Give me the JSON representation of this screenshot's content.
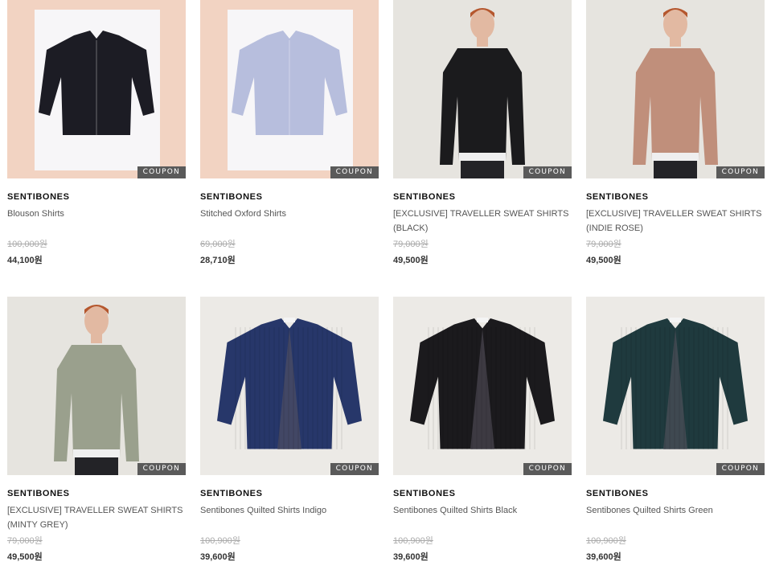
{
  "products": [
    {
      "brand": "SENTIBONES",
      "name": "Blouson Shirts",
      "old_price": "100,000원",
      "price": "44,100원",
      "coupon": "COUPON",
      "bg": "#f2d3c2",
      "shirt": "#1c1c24",
      "kind": "flat-paper"
    },
    {
      "brand": "SENTIBONES",
      "name": "Stitched Oxford Shirts",
      "old_price": "69,000원",
      "price": "28,710원",
      "coupon": "COUPON",
      "bg": "#f2d3c2",
      "shirt": "#b7bedd",
      "kind": "flat-paper"
    },
    {
      "brand": "SENTIBONES",
      "name": "[EXCLUSIVE] TRAVELLER SWEAT SHIRTS (BLACK)",
      "old_price": "79,000원",
      "price": "49,500원",
      "coupon": "COUPON",
      "bg": "#e6e4df",
      "shirt": "#1b1b1d",
      "kind": "model"
    },
    {
      "brand": "SENTIBONES",
      "name": "[EXCLUSIVE] TRAVELLER SWEAT SHIRTS (INDIE ROSE)",
      "old_price": "79,000원",
      "price": "49,500원",
      "coupon": "COUPON",
      "bg": "#e6e4df",
      "shirt": "#c08f7b",
      "kind": "model"
    },
    {
      "brand": "SENTIBONES",
      "name": "[EXCLUSIVE] TRAVELLER SWEAT SHIRTS (MINTY GREY)",
      "old_price": "79,000원",
      "price": "49,500원",
      "coupon": "COUPON",
      "bg": "#e6e4df",
      "shirt": "#9aa08d",
      "kind": "model"
    },
    {
      "brand": "SENTIBONES",
      "name": "Sentibones Quilted Shirts Indigo",
      "old_price": "100,900원",
      "price": "39,600원",
      "coupon": "COUPON",
      "bg": "#eceae6",
      "shirt": "#27376a",
      "kind": "flat"
    },
    {
      "brand": "SENTIBONES",
      "name": "Sentibones Quilted Shirts Black",
      "old_price": "100,900원",
      "price": "39,600원",
      "coupon": "COUPON",
      "bg": "#eceae6",
      "shirt": "#1b1a1d",
      "kind": "flat"
    },
    {
      "brand": "SENTIBONES",
      "name": "Sentibones Quilted Shirts Green",
      "old_price": "100,900원",
      "price": "39,600원",
      "coupon": "COUPON",
      "bg": "#eceae6",
      "shirt": "#1f3a3e",
      "kind": "flat"
    }
  ]
}
